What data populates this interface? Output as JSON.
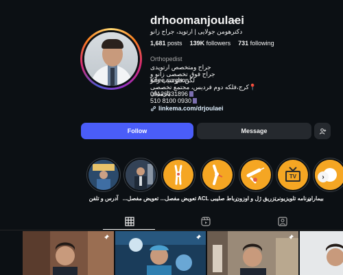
{
  "profile": {
    "username": "drhoomanjoulaei",
    "full_name": "دکترهومن جولایی | ارتوپد، جراح زانو",
    "stats": [
      {
        "value": "1,681",
        "label": "posts"
      },
      {
        "value": "139K",
        "label": "followers"
      },
      {
        "value": "731",
        "label": "following"
      }
    ],
    "category": "Orthopedist",
    "bio_lines": [
      "جراح ومتخصص ارتوپدی",
      "جراح فوق تخصصی زانو و لگن،فلوشیپ زانو",
      "Knee surgeon",
      "📍کرج،فلکه دوم فردیس، مجتمع تخصصی پارسیان",
      "09126331896",
      "510 8100 0930"
    ],
    "link": "linkema.com/drjoulaei"
  },
  "buttons": {
    "follow": "Follow",
    "message": "Message",
    "suggest_icon": "add-person-icon"
  },
  "highlights": [
    {
      "label": "آدرس و تلفن",
      "icon": "photo"
    },
    {
      "label": "تعویض مفصل...",
      "icon": "photo"
    },
    {
      "label": "تعویض مفصل...",
      "icon": "knee-icon"
    },
    {
      "label": "رباط صلیبی ACL",
      "icon": "knee-icon"
    },
    {
      "label": "تزریق ژل و اوزون",
      "icon": "syringe-icon"
    },
    {
      "label": "برنامه تلویزیونی",
      "icon": "tv-icon"
    },
    {
      "label": "بیماران",
      "icon": "photo"
    }
  ],
  "tabs": [
    {
      "name": "posts",
      "icon": "grid-icon",
      "active": true
    },
    {
      "name": "reels",
      "icon": "reels-icon",
      "active": false
    },
    {
      "name": "tagged",
      "icon": "tagged-icon",
      "active": false
    }
  ],
  "colors": {
    "background": "#0c1014",
    "follow_button": "#4a5df9",
    "secondary_button": "#25292e",
    "highlight_orange": "#f5a623",
    "link": "#e0f1ff"
  }
}
